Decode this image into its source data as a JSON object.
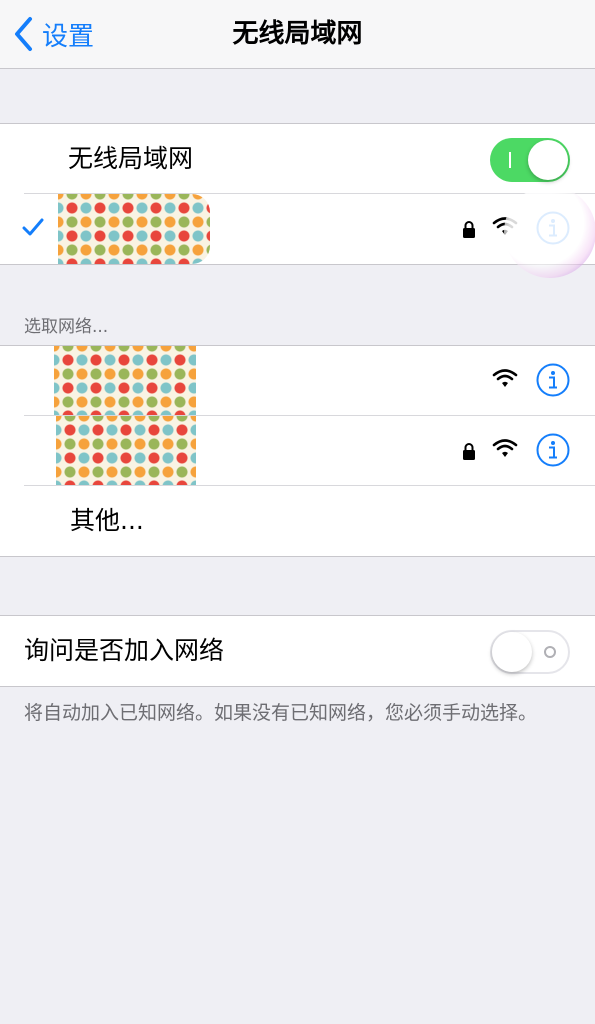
{
  "nav": {
    "back_label": "设置",
    "title": "无线局域网"
  },
  "wifi": {
    "label": "无线局域网",
    "enabled": true
  },
  "connected_network": {
    "name": "",
    "secured": true
  },
  "choose_header": "选取网络...",
  "networks": [
    {
      "name": "",
      "secured": false
    },
    {
      "name": "",
      "secured": true
    }
  ],
  "other_label": "其他...",
  "ask_to_join": {
    "label": "询问是否加入网络",
    "enabled": false,
    "footer": "将自动加入已知网络。如果没有已知网络，您必须手动选择。"
  },
  "colors": {
    "accent": "#147efb",
    "toggle_on": "#4cd964",
    "background": "#efeff4"
  },
  "icons": [
    "chevron-left-icon",
    "checkmark-icon",
    "lock-icon",
    "wifi-icon",
    "info-icon"
  ]
}
